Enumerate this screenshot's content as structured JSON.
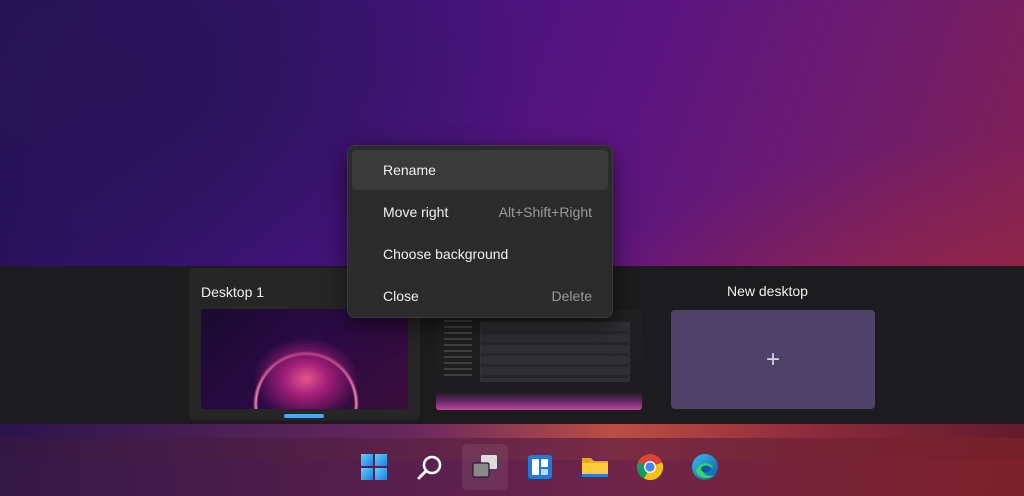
{
  "task_view": {
    "desktops": [
      {
        "label": "Desktop 1"
      },
      {
        "label": ""
      }
    ],
    "new_desktop_label": "New desktop",
    "add_icon": "plus-icon"
  },
  "context_menu": {
    "items": [
      {
        "label": "Rename",
        "shortcut": ""
      },
      {
        "label": "Move right",
        "shortcut": "Alt+Shift+Right"
      },
      {
        "label": "Choose background",
        "shortcut": ""
      },
      {
        "label": "Close",
        "shortcut": "Delete"
      }
    ]
  },
  "taskbar": {
    "icons": [
      "start-icon",
      "search-icon",
      "task-view-icon",
      "widgets-icon",
      "file-explorer-icon",
      "chrome-icon",
      "edge-icon"
    ]
  },
  "colors": {
    "accent": "#4aa8ff",
    "menu_bg": "#2b2b2b",
    "new_desktop_bg": "#4f4268"
  }
}
